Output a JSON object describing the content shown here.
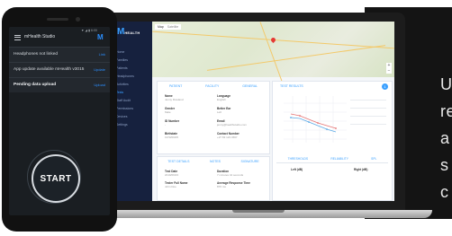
{
  "side_panel": {
    "lines": [
      "U",
      "re",
      "a",
      "s",
      "c"
    ],
    "bg_color": "#141414"
  },
  "phone": {
    "status_time": "▼ ◢ ▮ 6:00",
    "app_title": "mHealth Studio",
    "logo_text": "M",
    "rows": [
      {
        "text": "Headphones not linked",
        "action": "Link"
      },
      {
        "text": "App update available mHealth v3015",
        "action": "Update"
      },
      {
        "text": "Pending data upload",
        "action": "Upload"
      }
    ],
    "start_label": "START",
    "accent": "#2b8fff"
  },
  "laptop": {
    "nav": {
      "logo": "M",
      "logo_sub": "HEALTH",
      "items": [
        "Home",
        "Families",
        "Patients",
        "Headphones",
        "Activities",
        "Tests",
        "Staff Audit",
        "Permissions",
        "Devices",
        "Settings"
      ],
      "active_index": 5
    },
    "map": {
      "tabs": [
        "Map",
        "Satellite"
      ],
      "zoom": [
        "+",
        "−"
      ]
    },
    "patient_card": {
      "tabs": [
        "PATIENT",
        "FACILITY",
        "GENERAL"
      ],
      "fields": [
        {
          "label": "Name",
          "value": "Jenny Rowland"
        },
        {
          "label": "Language",
          "value": "English"
        },
        {
          "label": "Gender",
          "value": "Male"
        },
        {
          "label": "Better Ear",
          "value": "Left"
        },
        {
          "label": "ID Number",
          "value": "-"
        },
        {
          "label": "Email",
          "value": "jenny@healthstudio.com"
        },
        {
          "label": "Birthdate",
          "value": "1970/09/05"
        },
        {
          "label": "Contact Number",
          "value": "+27 83 123 4567"
        }
      ]
    },
    "test_details": {
      "tabs": [
        "TEST DETAILS",
        "NOTES",
        "SIGNATURE"
      ],
      "fields": [
        {
          "label": "Test Date",
          "value": "2019/09/23"
        },
        {
          "label": "Duration",
          "value": "7 minutes 44 seconds"
        },
        {
          "label": "Tester Full Name",
          "value": "John Doe"
        },
        {
          "label": "Average Response Time",
          "value": "876 ms"
        }
      ]
    },
    "results_card": {
      "title": "TEST RESULTS",
      "badge": "1",
      "lower_tabs": [
        "THRESHOLDS",
        "RELIABILITY",
        "SPL"
      ],
      "left_label": "Left (dB)",
      "right_label": "Right (dB)"
    }
  }
}
